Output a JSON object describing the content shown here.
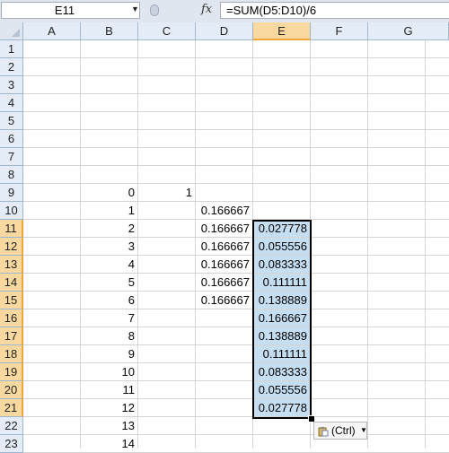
{
  "formula_bar": {
    "name_box": "E11",
    "fx_label": "fx",
    "formula": "=SUM(D5:D10)/6"
  },
  "columns": [
    "A",
    "B",
    "C",
    "D",
    "E",
    "F",
    "G"
  ],
  "selected_column": "E",
  "rows": [
    "1",
    "2",
    "3",
    "4",
    "5",
    "6",
    "7",
    "8",
    "9",
    "10",
    "11",
    "12",
    "13",
    "14",
    "15",
    "16",
    "17",
    "18",
    "19",
    "20",
    "21",
    "22",
    "23"
  ],
  "selected_rows": [
    "11",
    "12",
    "13",
    "14",
    "15",
    "16",
    "17",
    "18",
    "19",
    "20",
    "21"
  ],
  "cells": {
    "B9": "0",
    "B10": "1",
    "B11": "2",
    "B12": "3",
    "B13": "4",
    "B14": "5",
    "B15": "6",
    "B16": "7",
    "B17": "8",
    "B18": "9",
    "B19": "10",
    "B20": "11",
    "B21": "12",
    "B22": "13",
    "B23": "14",
    "C9": "1",
    "D10": "0.166667",
    "D11": "0.166667",
    "D12": "0.166667",
    "D13": "0.166667",
    "D14": "0.166667",
    "D15": "0.166667",
    "E11": "0.027778",
    "E12": "0.055556",
    "E13": "0.083333",
    "E14": "0.111111",
    "E15": "0.138889",
    "E16": "0.166667",
    "E17": "0.138889",
    "E18": "0.111111",
    "E19": "0.083333",
    "E20": "0.055556",
    "E21": "0.027778"
  },
  "paste_options": {
    "label": "(Ctrl)"
  },
  "colors": {
    "selection_fill": "#c6def2",
    "header_highlight": "#f9d99f",
    "header_highlight_border": "#f2a53a"
  }
}
